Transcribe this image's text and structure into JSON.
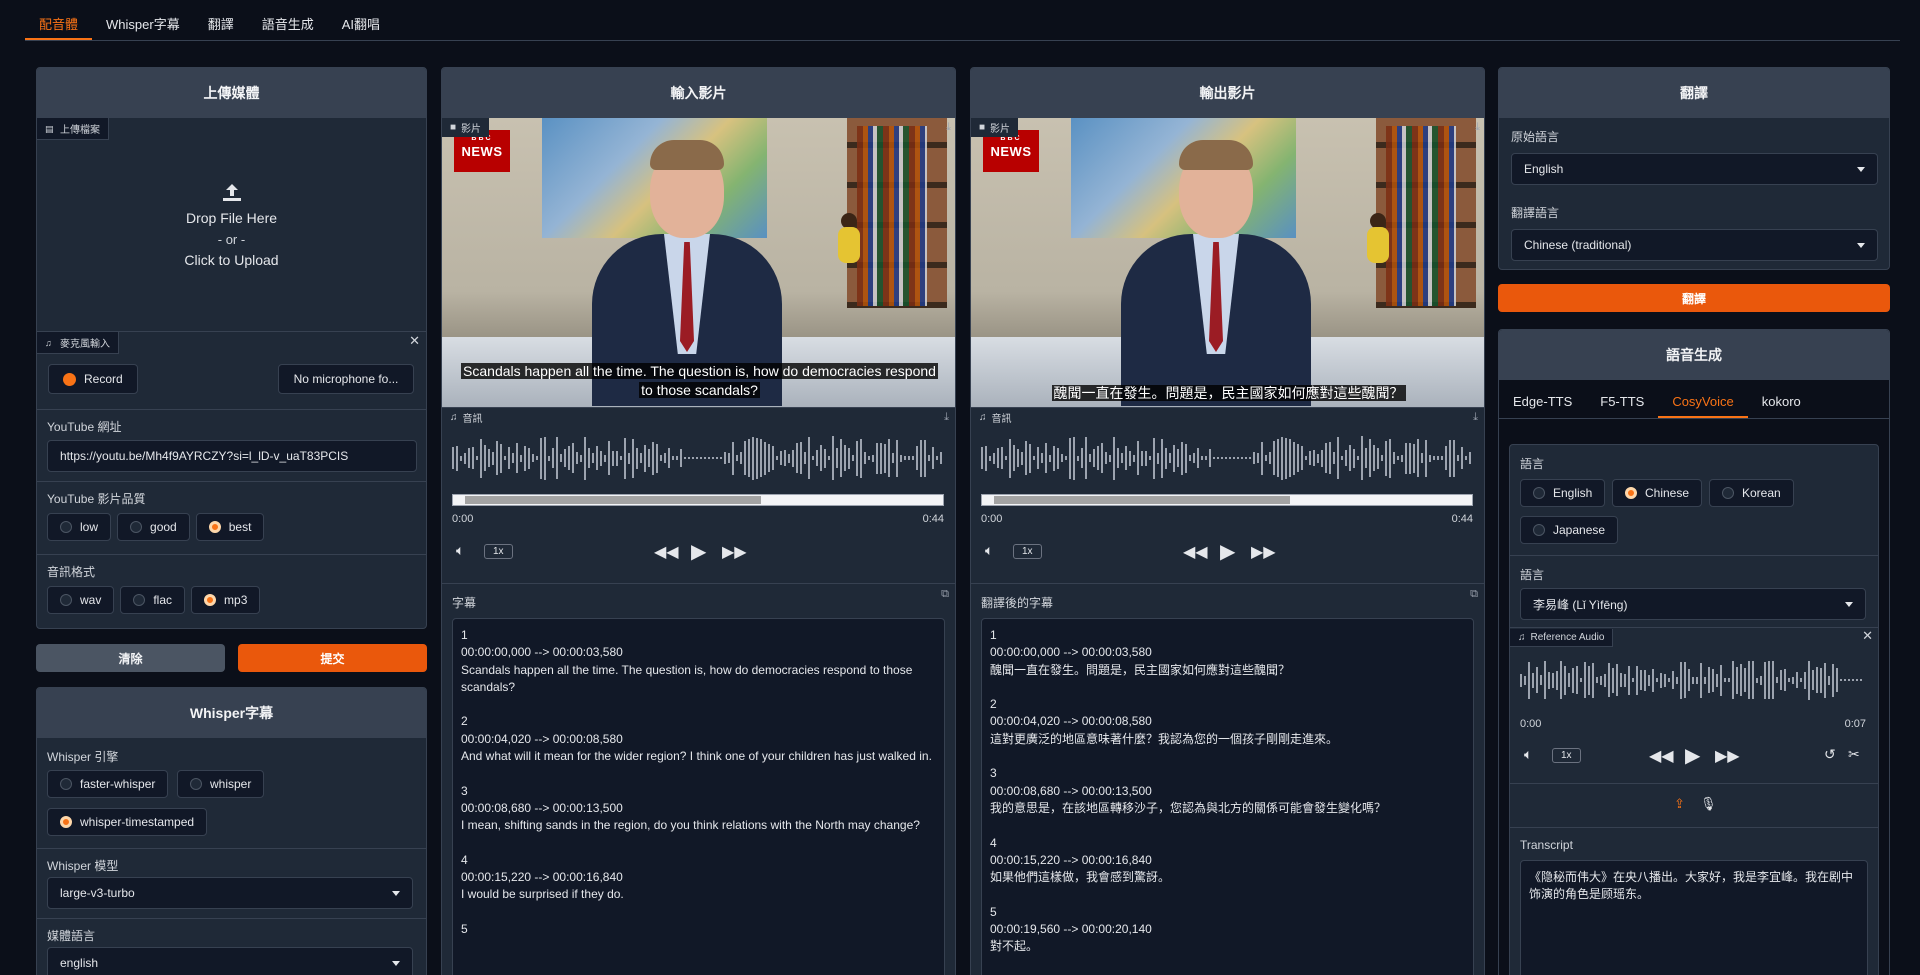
{
  "top_tabs": [
    "配音體",
    "Whisper字幕",
    "翻譯",
    "語音生成",
    "AI翻唱"
  ],
  "upload": {
    "title": "上傳媒體",
    "file_label": "上傳檔案",
    "drop": "Drop File Here",
    "or": "- or -",
    "click": "Click to Upload",
    "mic_label": "麥克風輸入",
    "record": "Record",
    "no_mic": "No microphone fo...",
    "youtube_label": "YouTube 網址",
    "youtube_value": "https://youtu.be/Mh4f9AYRCZY?si=l_lD-v_uaT83PCIS",
    "quality_label": "YouTube 影片品質",
    "quality_options": [
      "low",
      "good",
      "best"
    ],
    "format_label": "音訊格式",
    "format_options": [
      "wav",
      "flac",
      "mp3"
    ],
    "clear": "清除",
    "submit": "提交"
  },
  "whisper": {
    "title": "Whisper字幕",
    "engine_label": "Whisper 引擎",
    "engines": [
      "faster-whisper",
      "whisper",
      "whisper-timestamped"
    ],
    "model_label": "Whisper 模型",
    "model_value": "large-v3-turbo",
    "lang_label": "媒體語言",
    "lang_value": "english"
  },
  "input_video": {
    "title": "輸入影片",
    "video_label": "影片",
    "audio_label": "音訊",
    "subtitle_line1": "Scandals happen all the time. The question is, how do democracies respond",
    "subtitle_line2": "to those scandals?",
    "time_start": "0:00",
    "time_end": "0:44",
    "speed": "1x",
    "subs_label": "字幕",
    "subs_text": "1\n00:00:00,000 --> 00:00:03,580\nScandals happen all the time. The question is, how do democracies respond to those scandals?\n\n2\n00:00:04,020 --> 00:00:08,580\nAnd what will it mean for the wider region? I think one of your children has just walked in.\n\n3\n00:00:08,680 --> 00:00:13,500\nI mean, shifting sands in the region, do you think relations with the North may change?\n\n4\n00:00:15,220 --> 00:00:16,840\nI would be surprised if they do.\n\n5"
  },
  "output_video": {
    "title": "輸出影片",
    "video_label": "影片",
    "audio_label": "音訊",
    "subtitle_line1": "醜聞一直在發生。問題是，民主國家如何應對這些醜聞？",
    "time_start": "0:00",
    "time_end": "0:44",
    "speed": "1x",
    "subs_label": "翻譯後的字幕",
    "subs_text": "1\n00:00:00,000 --> 00:00:03,580\n醜聞一直在發生。問題是，民主國家如何應對這些醜聞？\n\n2\n00:00:04,020 --> 00:00:08,580\n這對更廣泛的地區意味著什麼？我認為您的一個孩子剛剛走進來。\n\n3\n00:00:08,680 --> 00:00:13,500\n我的意思是，在該地區轉移沙子，您認為與北方的關係可能會發生變化嗎？\n\n4\n00:00:15,220 --> 00:00:16,840\n如果他們這樣做，我會感到驚訝。\n\n5\n00:00:19,560 --> 00:00:20,140\n對不起。"
  },
  "translate": {
    "title": "翻譯",
    "source_label": "原始語言",
    "source_value": "English",
    "target_label": "翻譯語言",
    "target_value": "Chinese (traditional)",
    "button": "翻譯"
  },
  "tts": {
    "title": "語音生成",
    "tabs": [
      "Edge-TTS",
      "F5-TTS",
      "CosyVoice",
      "kokoro"
    ],
    "lang_label": "語言",
    "langs": [
      "English",
      "Chinese",
      "Korean",
      "Japanese"
    ],
    "voice_label": "語言",
    "voice_value": "李易峰 (Lǐ Yìfēng)",
    "ref_label": "Reference Audio",
    "time_start": "0:00",
    "time_end": "0:07",
    "speed": "1x",
    "transcript_label": "Transcript",
    "transcript_text": "《隐秘而伟大》在央八播出。大家好，我是李宜峰。我在剧中饰演的角色是顾瑶东。"
  },
  "colors": {
    "accent": "#f97316",
    "bg": "#0b0f19",
    "panel": "#1f2937"
  }
}
